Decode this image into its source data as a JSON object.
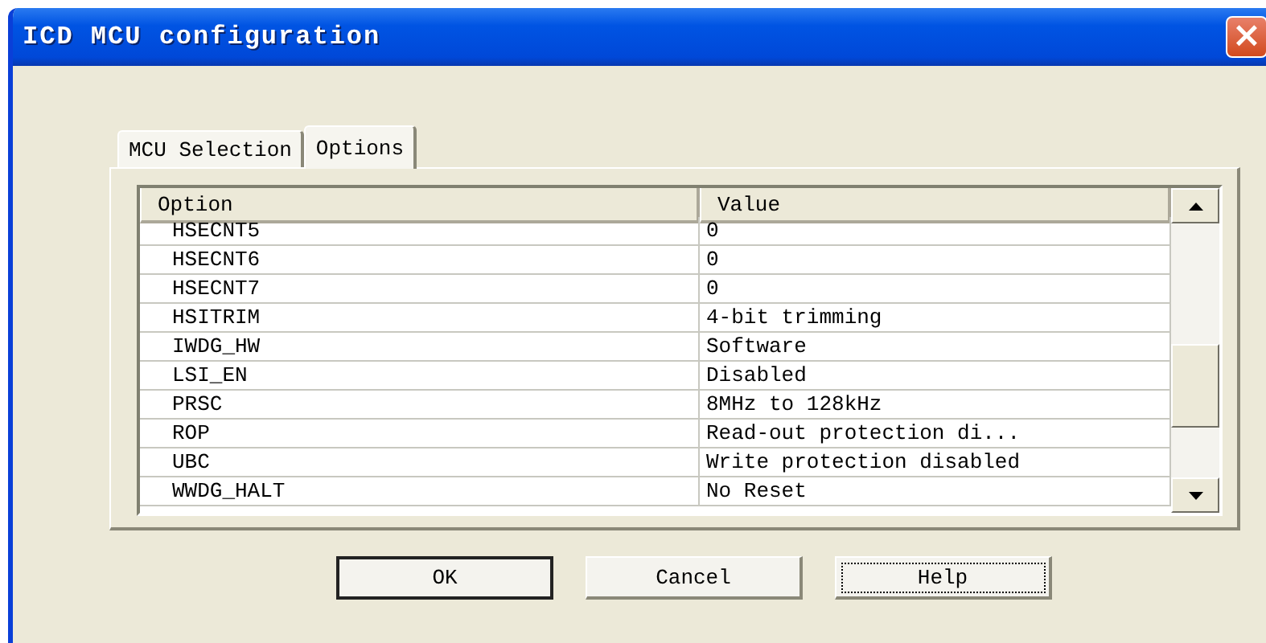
{
  "window": {
    "title": "ICD MCU configuration",
    "close_button": "×"
  },
  "tabs": [
    {
      "label": "MCU Selection",
      "selected": false
    },
    {
      "label": "Options",
      "selected": true
    }
  ],
  "table": {
    "columns": [
      "Option",
      "Value"
    ],
    "rows": [
      {
        "option": "HSECNT5",
        "value": "0"
      },
      {
        "option": "HSECNT6",
        "value": "0"
      },
      {
        "option": "HSECNT7",
        "value": "0"
      },
      {
        "option": "HSITRIM",
        "value": "4-bit trimming"
      },
      {
        "option": "IWDG_HW",
        "value": "Software"
      },
      {
        "option": "LSI_EN",
        "value": "Disabled"
      },
      {
        "option": "PRSC",
        "value": "8MHz to 128kHz"
      },
      {
        "option": "ROP",
        "value": "Read-out protection di..."
      },
      {
        "option": "UBC",
        "value": "Write protection disabled"
      },
      {
        "option": "WWDG_HALT",
        "value": "No Reset"
      }
    ]
  },
  "buttons": [
    {
      "label": "OK",
      "default": true,
      "focused": false
    },
    {
      "label": "Cancel",
      "default": false,
      "focused": false
    },
    {
      "label": "Help",
      "default": false,
      "focused": true
    }
  ]
}
